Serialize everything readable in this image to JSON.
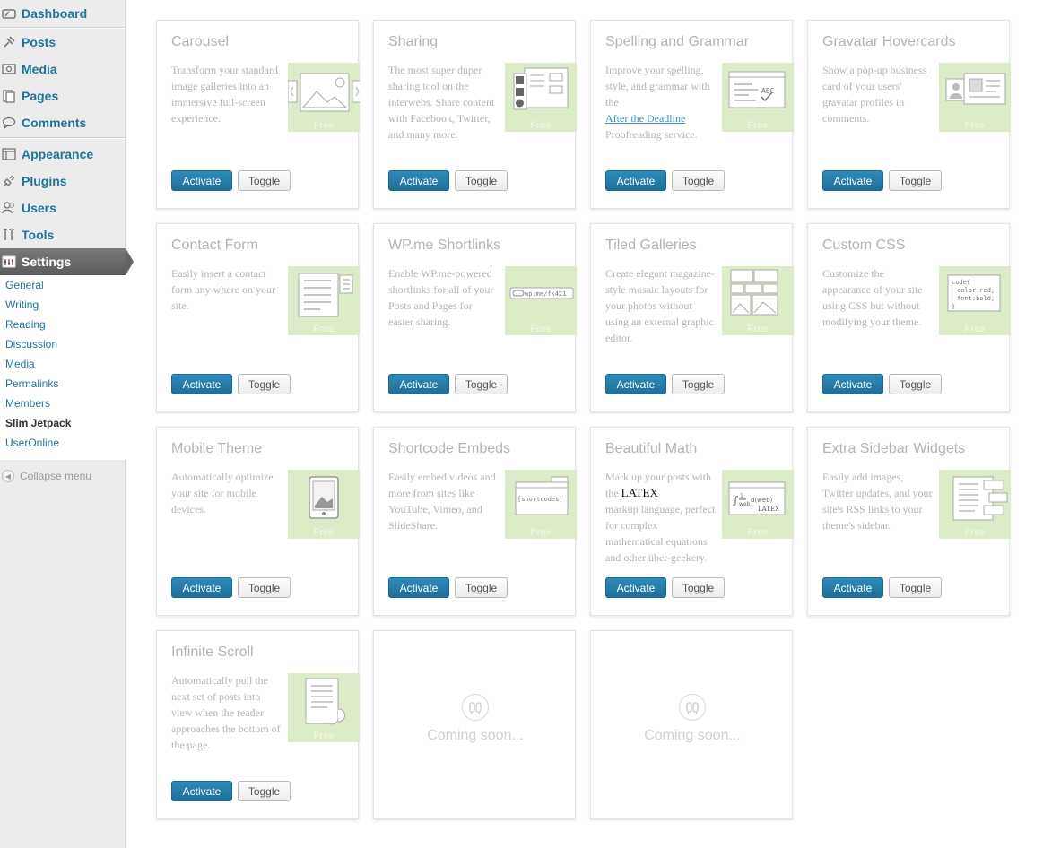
{
  "sidebar": {
    "menu": {
      "dashboard": "Dashboard",
      "posts": "Posts",
      "media": "Media",
      "pages": "Pages",
      "comments": "Comments",
      "appearance": "Appearance",
      "plugins": "Plugins",
      "users": "Users",
      "tools": "Tools",
      "settings": "Settings"
    },
    "submenu": [
      "General",
      "Writing",
      "Reading",
      "Discussion",
      "Media",
      "Permalinks",
      "Members",
      "Slim Jetpack",
      "UserOnline"
    ],
    "submenu_active": "Slim Jetpack",
    "collapse": "Collapse menu"
  },
  "buttons": {
    "activate": "Activate",
    "toggle": "Toggle"
  },
  "free_label": "Free",
  "coming_soon": "Coming soon...",
  "modules": [
    {
      "title": "Carousel",
      "desc": "Transform your standard image galleries into an immersive full-screen experience.",
      "icon": "carousel-illustration"
    },
    {
      "title": "Sharing",
      "desc": "The most super duper sharing tool on the interwebs. Share content with Facebook, Twitter, and many more.",
      "icon": "sharing-illustration"
    },
    {
      "title": "Spelling and Grammar",
      "desc_before": "Improve your spelling, style, and grammar with the",
      "link": "After the Deadline",
      "desc_after": "Proofreading service.",
      "icon": "spelling-illustration"
    },
    {
      "title": "Gravatar Hovercards",
      "desc": "Show a pop-up business card of your users' gravatar profiles in comments.",
      "icon": "gravatar-illustration"
    },
    {
      "title": "Contact Form",
      "desc": "Easily insert a contact form any where on your site.",
      "icon": "contact-form-illustration"
    },
    {
      "title": "WP.me Shortlinks",
      "desc": "Enable WP.me-powered shortlinks for all of your Posts and Pages for easier sharing.",
      "icon": "shortlinks-illustration",
      "image_text": "wp.me/fk421"
    },
    {
      "title": "Tiled Galleries",
      "desc": "Create elegant magazine-style mosaic layouts for your photos without using an external graphic editor.",
      "icon": "tiled-galleries-illustration"
    },
    {
      "title": "Custom CSS",
      "desc": "Customize the appearance of your site using CSS but without modifying your theme.",
      "icon": "custom-css-illustration",
      "image_text": [
        "code{",
        "color:red;",
        "font:bold;",
        "}"
      ]
    },
    {
      "title": "Mobile Theme",
      "desc": "Automatically optimize your site for mobile devices.",
      "icon": "mobile-illustration"
    },
    {
      "title": "Shortcode Embeds",
      "desc": "Easily embed videos and more from sites like YouTube, Vimeo, and SlideShare.",
      "icon": "shortcode-illustration",
      "image_text": "[shortcodes]"
    },
    {
      "title": "Beautiful Math",
      "desc_before": "Mark up your posts with the",
      "latex": "LATEX",
      "desc_after": "markup language, perfect for complex mathematical equations and other über-geekery.",
      "icon": "math-illustration"
    },
    {
      "title": "Extra Sidebar Widgets",
      "desc": "Easily add images, Twitter updates, and your site's RSS links to your theme's sidebar.",
      "icon": "widgets-illustration"
    },
    {
      "title": "Infinite Scroll",
      "desc": "Automatically pull the next set of posts into view when the reader approaches the bottom of the page.",
      "icon": "infinite-scroll-illustration"
    }
  ]
}
